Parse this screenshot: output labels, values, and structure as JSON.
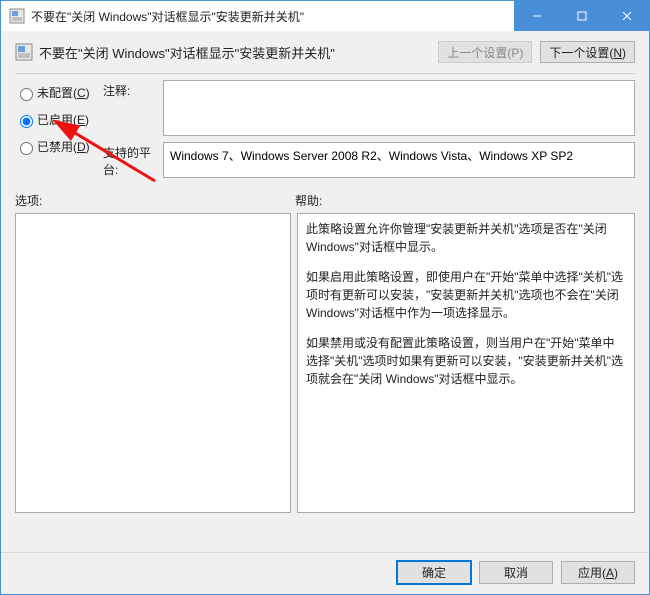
{
  "window": {
    "title": "不要在\"关闭 Windows\"对话框显示\"安装更新并关机\""
  },
  "header": {
    "policy_title": "不要在\"关闭 Windows\"对话框显示\"安装更新并关机\"",
    "prev_btn": "上一个设置(P)",
    "next_btn_pre": "下一个设置(",
    "next_btn_hot": "N",
    "next_btn_suf": ")"
  },
  "radios": {
    "not_configured_pre": "未配置(",
    "not_configured_hot": "C",
    "not_configured_suf": ")",
    "enabled_pre": "已启用(",
    "enabled_hot": "E",
    "enabled_suf": ")",
    "disabled_pre": "已禁用(",
    "disabled_hot": "D",
    "disabled_suf": ")"
  },
  "fields": {
    "comment_label": "注释:",
    "comment_value": "",
    "platform_label": "支持的平台:",
    "platform_value": "Windows 7、Windows Server 2008 R2、Windows Vista、Windows XP SP2"
  },
  "labels": {
    "options": "选项:",
    "help": "帮助:"
  },
  "help": {
    "p1": "此策略设置允许你管理\"安装更新并关机\"选项是否在\"关闭 Windows\"对话框中显示。",
    "p2": "如果启用此策略设置，即使用户在\"开始\"菜单中选择\"关机\"选项时有更新可以安装，\"安装更新并关机\"选项也不会在\"关闭 Windows\"对话框中作为一项选择显示。",
    "p3": "如果禁用或没有配置此策略设置，则当用户在\"开始\"菜单中选择\"关机\"选项时如果有更新可以安装，\"安装更新并关机\"选项就会在\"关闭 Windows\"对话框中显示。"
  },
  "footer": {
    "ok": "确定",
    "cancel": "取消",
    "apply_pre": "应用(",
    "apply_hot": "A",
    "apply_suf": ")"
  }
}
